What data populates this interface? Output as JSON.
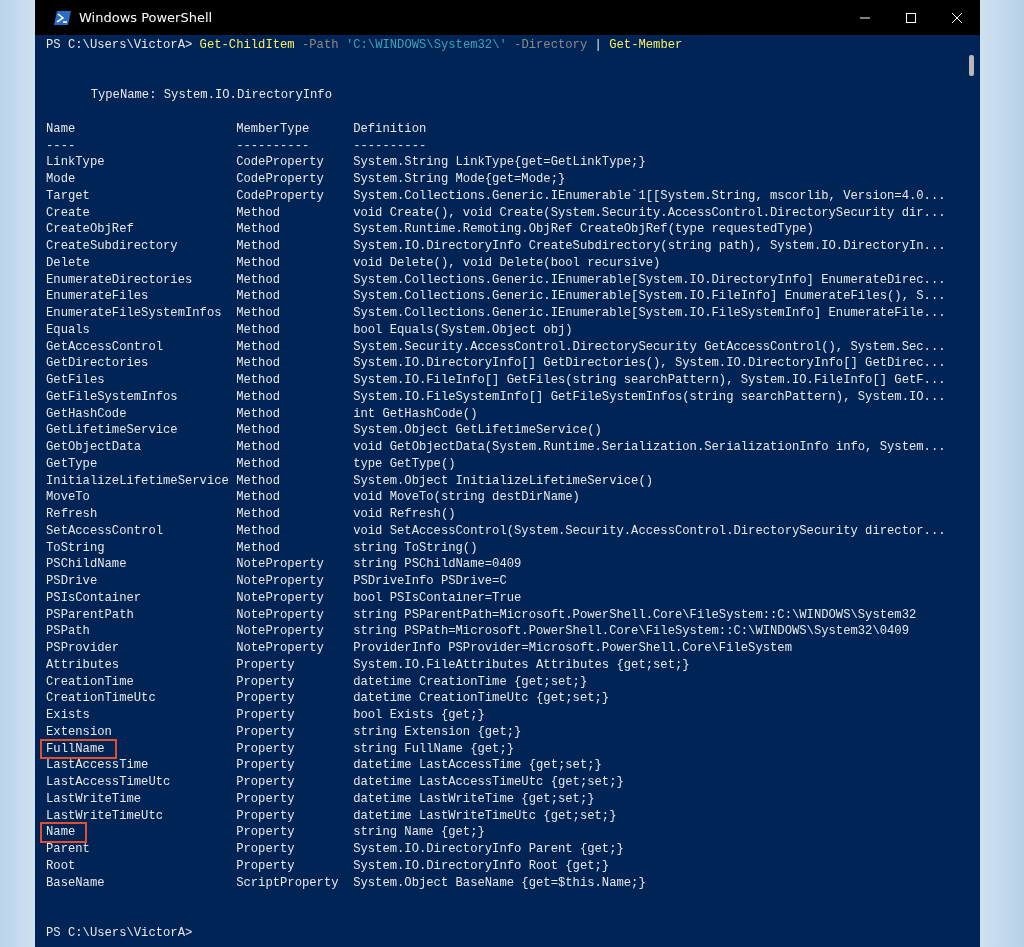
{
  "window": {
    "title": "Windows PowerShell"
  },
  "command_line": [
    {
      "kind": "prompt",
      "text": "PS C:\\Users\\VictorA>"
    },
    {
      "kind": "command",
      "text": "Get-ChildItem"
    },
    {
      "kind": "parameter",
      "text": "-Path"
    },
    {
      "kind": "string",
      "text": "'C:\\WINDOWS\\System32\\'"
    },
    {
      "kind": "parameter",
      "text": "-Directory"
    },
    {
      "kind": "operator",
      "text": "|"
    },
    {
      "kind": "command",
      "text": "Get-Member"
    }
  ],
  "type_name": "TypeName: System.IO.DirectoryInfo",
  "table": {
    "columns": [
      "Name",
      "MemberType",
      "Definition"
    ],
    "separators": [
      "----",
      "----------",
      "----------"
    ],
    "rows": [
      {
        "name": "LinkType",
        "member_type": "CodeProperty",
        "definition": "System.String LinkType{get=GetLinkType;}",
        "highlighted": false
      },
      {
        "name": "Mode",
        "member_type": "CodeProperty",
        "definition": "System.String Mode{get=Mode;}",
        "highlighted": false
      },
      {
        "name": "Target",
        "member_type": "CodeProperty",
        "definition": "System.Collections.Generic.IEnumerable`1[[System.String, mscorlib, Version=4.0...",
        "highlighted": false
      },
      {
        "name": "Create",
        "member_type": "Method",
        "definition": "void Create(), void Create(System.Security.AccessControl.DirectorySecurity dir...",
        "highlighted": false
      },
      {
        "name": "CreateObjRef",
        "member_type": "Method",
        "definition": "System.Runtime.Remoting.ObjRef CreateObjRef(type requestedType)",
        "highlighted": false
      },
      {
        "name": "CreateSubdirectory",
        "member_type": "Method",
        "definition": "System.IO.DirectoryInfo CreateSubdirectory(string path), System.IO.DirectoryIn...",
        "highlighted": false
      },
      {
        "name": "Delete",
        "member_type": "Method",
        "definition": "void Delete(), void Delete(bool recursive)",
        "highlighted": false
      },
      {
        "name": "EnumerateDirectories",
        "member_type": "Method",
        "definition": "System.Collections.Generic.IEnumerable[System.IO.DirectoryInfo] EnumerateDirec...",
        "highlighted": false
      },
      {
        "name": "EnumerateFiles",
        "member_type": "Method",
        "definition": "System.Collections.Generic.IEnumerable[System.IO.FileInfo] EnumerateFiles(), S...",
        "highlighted": false
      },
      {
        "name": "EnumerateFileSystemInfos",
        "member_type": "Method",
        "definition": "System.Collections.Generic.IEnumerable[System.IO.FileSystemInfo] EnumerateFile...",
        "highlighted": false
      },
      {
        "name": "Equals",
        "member_type": "Method",
        "definition": "bool Equals(System.Object obj)",
        "highlighted": false
      },
      {
        "name": "GetAccessControl",
        "member_type": "Method",
        "definition": "System.Security.AccessControl.DirectorySecurity GetAccessControl(), System.Sec...",
        "highlighted": false
      },
      {
        "name": "GetDirectories",
        "member_type": "Method",
        "definition": "System.IO.DirectoryInfo[] GetDirectories(), System.IO.DirectoryInfo[] GetDirec...",
        "highlighted": false
      },
      {
        "name": "GetFiles",
        "member_type": "Method",
        "definition": "System.IO.FileInfo[] GetFiles(string searchPattern), System.IO.FileInfo[] GetF...",
        "highlighted": false
      },
      {
        "name": "GetFileSystemInfos",
        "member_type": "Method",
        "definition": "System.IO.FileSystemInfo[] GetFileSystemInfos(string searchPattern), System.IO...",
        "highlighted": false
      },
      {
        "name": "GetHashCode",
        "member_type": "Method",
        "definition": "int GetHashCode()",
        "highlighted": false
      },
      {
        "name": "GetLifetimeService",
        "member_type": "Method",
        "definition": "System.Object GetLifetimeService()",
        "highlighted": false
      },
      {
        "name": "GetObjectData",
        "member_type": "Method",
        "definition": "void GetObjectData(System.Runtime.Serialization.SerializationInfo info, System...",
        "highlighted": false
      },
      {
        "name": "GetType",
        "member_type": "Method",
        "definition": "type GetType()",
        "highlighted": false
      },
      {
        "name": "InitializeLifetimeService",
        "member_type": "Method",
        "definition": "System.Object InitializeLifetimeService()",
        "highlighted": false
      },
      {
        "name": "MoveTo",
        "member_type": "Method",
        "definition": "void MoveTo(string destDirName)",
        "highlighted": false
      },
      {
        "name": "Refresh",
        "member_type": "Method",
        "definition": "void Refresh()",
        "highlighted": false
      },
      {
        "name": "SetAccessControl",
        "member_type": "Method",
        "definition": "void SetAccessControl(System.Security.AccessControl.DirectorySecurity director...",
        "highlighted": false
      },
      {
        "name": "ToString",
        "member_type": "Method",
        "definition": "string ToString()",
        "highlighted": false
      },
      {
        "name": "PSChildName",
        "member_type": "NoteProperty",
        "definition": "string PSChildName=0409",
        "highlighted": false
      },
      {
        "name": "PSDrive",
        "member_type": "NoteProperty",
        "definition": "PSDriveInfo PSDrive=C",
        "highlighted": false
      },
      {
        "name": "PSIsContainer",
        "member_type": "NoteProperty",
        "definition": "bool PSIsContainer=True",
        "highlighted": false
      },
      {
        "name": "PSParentPath",
        "member_type": "NoteProperty",
        "definition": "string PSParentPath=Microsoft.PowerShell.Core\\FileSystem::C:\\WINDOWS\\System32",
        "highlighted": false
      },
      {
        "name": "PSPath",
        "member_type": "NoteProperty",
        "definition": "string PSPath=Microsoft.PowerShell.Core\\FileSystem::C:\\WINDOWS\\System32\\0409",
        "highlighted": false
      },
      {
        "name": "PSProvider",
        "member_type": "NoteProperty",
        "definition": "ProviderInfo PSProvider=Microsoft.PowerShell.Core\\FileSystem",
        "highlighted": false
      },
      {
        "name": "Attributes",
        "member_type": "Property",
        "definition": "System.IO.FileAttributes Attributes {get;set;}",
        "highlighted": false
      },
      {
        "name": "CreationTime",
        "member_type": "Property",
        "definition": "datetime CreationTime {get;set;}",
        "highlighted": false
      },
      {
        "name": "CreationTimeUtc",
        "member_type": "Property",
        "definition": "datetime CreationTimeUtc {get;set;}",
        "highlighted": false
      },
      {
        "name": "Exists",
        "member_type": "Property",
        "definition": "bool Exists {get;}",
        "highlighted": false
      },
      {
        "name": "Extension",
        "member_type": "Property",
        "definition": "string Extension {get;}",
        "highlighted": false
      },
      {
        "name": "FullName",
        "member_type": "Property",
        "definition": "string FullName {get;}",
        "highlighted": true
      },
      {
        "name": "LastAccessTime",
        "member_type": "Property",
        "definition": "datetime LastAccessTime {get;set;}",
        "highlighted": false
      },
      {
        "name": "LastAccessTimeUtc",
        "member_type": "Property",
        "definition": "datetime LastAccessTimeUtc {get;set;}",
        "highlighted": false
      },
      {
        "name": "LastWriteTime",
        "member_type": "Property",
        "definition": "datetime LastWriteTime {get;set;}",
        "highlighted": false
      },
      {
        "name": "LastWriteTimeUtc",
        "member_type": "Property",
        "definition": "datetime LastWriteTimeUtc {get;set;}",
        "highlighted": false
      },
      {
        "name": "Name",
        "member_type": "Property",
        "definition": "string Name {get;}",
        "highlighted": true
      },
      {
        "name": "Parent",
        "member_type": "Property",
        "definition": "System.IO.DirectoryInfo Parent {get;}",
        "highlighted": false
      },
      {
        "name": "Root",
        "member_type": "Property",
        "definition": "System.IO.DirectoryInfo Root {get;}",
        "highlighted": false
      },
      {
        "name": "BaseName",
        "member_type": "ScriptProperty",
        "definition": "System.Object BaseName {get=$this.Name;}",
        "highlighted": false
      }
    ]
  },
  "final_prompt": "PS C:\\Users\\VictorA>"
}
